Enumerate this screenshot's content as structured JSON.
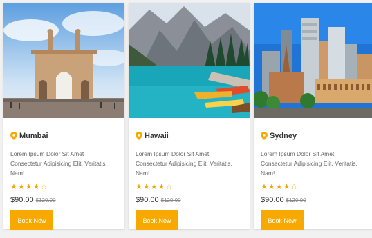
{
  "accent": "#f7a900",
  "cards": [
    {
      "location": "Mumbai",
      "description": "Lorem Ipsum Dolor Sit Amet Consectetur Adipisicing Elit. Veritatis, Nam!",
      "rating": 3.5,
      "price": "$90.00",
      "old_price": "$120.00",
      "button": "Book Now"
    },
    {
      "location": "Hawaii",
      "description": "Lorem Ipsum Dolor Sit Amet Consectetur Adipisicing Elit. Veritatis, Nam!",
      "rating": 3.5,
      "price": "$90.00",
      "old_price": "$120.00",
      "button": "Book Now"
    },
    {
      "location": "Sydney",
      "description": "Lorem Ipsum Dolor Sit Amet Consectetur Adipisicing Elit. Veritatis, Nam!",
      "rating": 3.5,
      "price": "$90.00",
      "old_price": "$120.00",
      "button": "Book Now"
    }
  ]
}
